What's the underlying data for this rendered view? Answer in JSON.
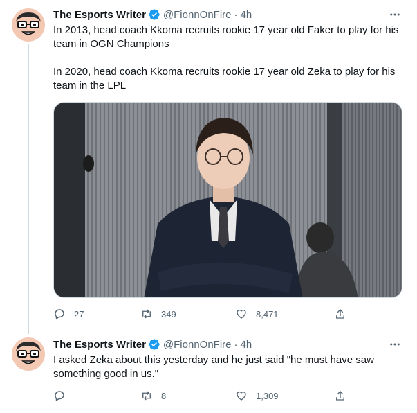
{
  "tweets": [
    {
      "author_name": "The Esports Writer",
      "handle": "@FionnOnFire",
      "separator": "·",
      "time": "4h",
      "paragraphs": [
        "In 2013, head coach Kkoma recruits rookie 17 year old Faker to play for his team in OGN Champions",
        "In 2020, head coach Kkoma recruits rookie 17 year old Zeka to play for his team in the LPL"
      ],
      "replies": "27",
      "retweets": "349",
      "likes": "8,471"
    },
    {
      "author_name": "The Esports Writer",
      "handle": "@FionnOnFire",
      "separator": "·",
      "time": "4h",
      "paragraphs": [
        "I asked Zeka about this yesterday and he just said \"he must have saw something good in us.\""
      ],
      "replies": "",
      "retweets": "8",
      "likes": "1,309"
    }
  ],
  "colors": {
    "verified": "#1d9bf0",
    "secondary_text": "#536471",
    "thread_line": "#cfd9de"
  }
}
